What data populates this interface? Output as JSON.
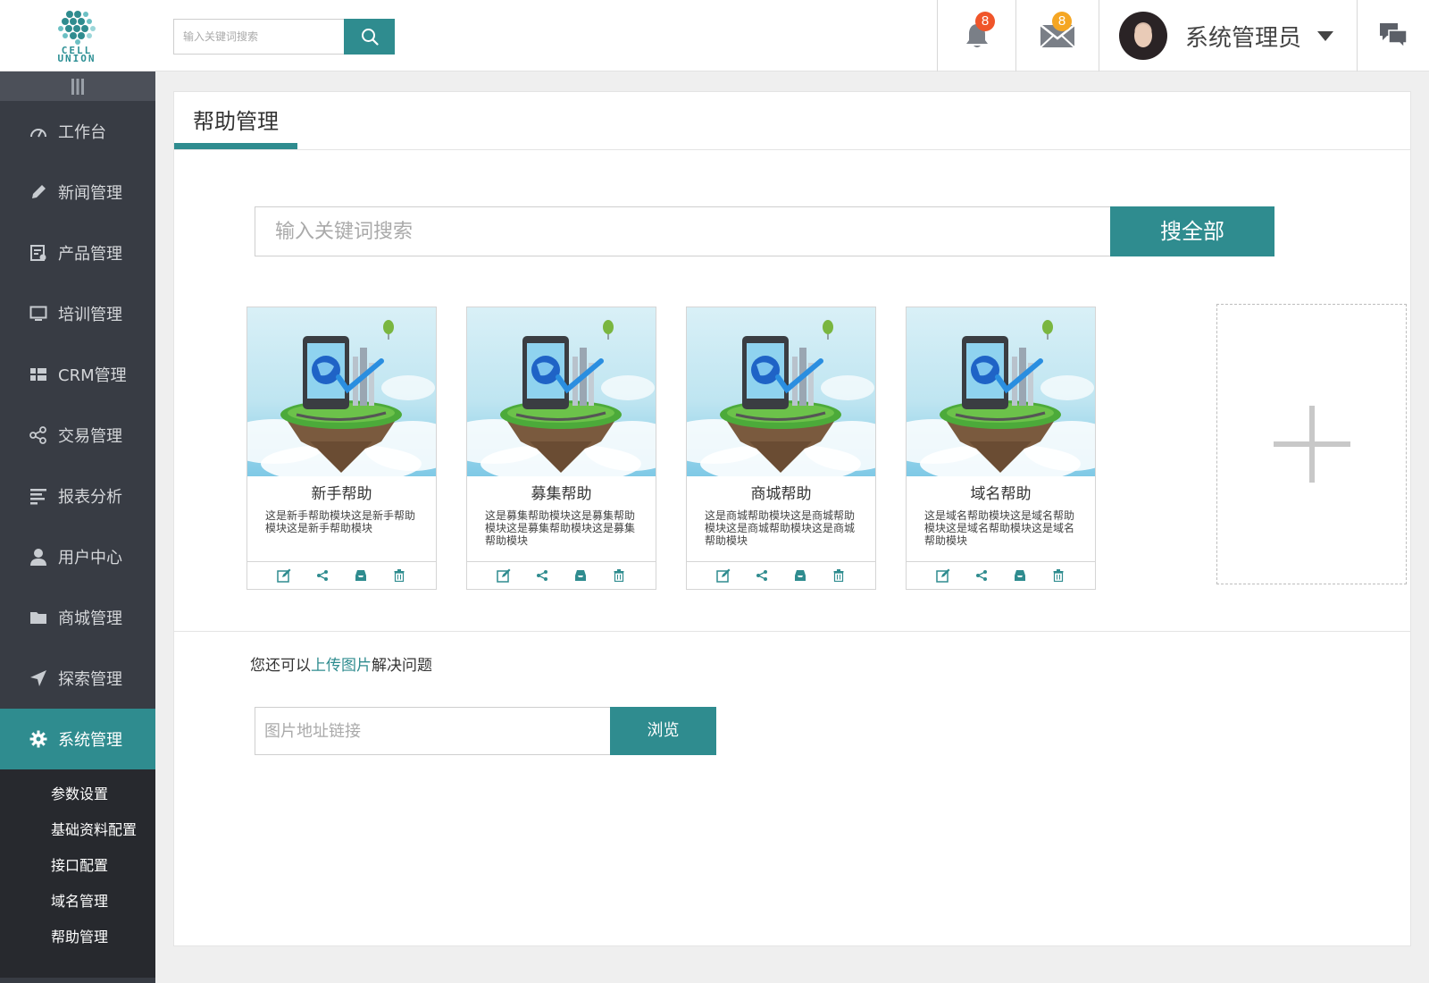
{
  "logo": {
    "line1": "CELL",
    "line2": "UNION",
    "brand_color": "#2f8c8f"
  },
  "header": {
    "search_placeholder": "输入关键词搜索",
    "search_icon": "search-icon",
    "notifications": {
      "icon": "bell-icon",
      "count": "8",
      "badge_color": "#f0552a"
    },
    "messages": {
      "icon": "mail-icon",
      "count": "8",
      "badge_color": "#f5a623"
    },
    "user": {
      "name": "系统管理员"
    },
    "chat_icon": "chat-icon"
  },
  "sidebar": {
    "items": [
      {
        "label": "工作台",
        "icon": "dashboard-icon"
      },
      {
        "label": "新闻管理",
        "icon": "pencil-icon"
      },
      {
        "label": "产品管理",
        "icon": "product-icon"
      },
      {
        "label": "培训管理",
        "icon": "monitor-icon"
      },
      {
        "label": "CRM管理",
        "icon": "grid-icon"
      },
      {
        "label": "交易管理",
        "icon": "share-icon"
      },
      {
        "label": "报表分析",
        "icon": "report-icon"
      },
      {
        "label": "用户中心",
        "icon": "user-icon"
      },
      {
        "label": "商城管理",
        "icon": "folder-icon"
      },
      {
        "label": "探索管理",
        "icon": "send-icon"
      },
      {
        "label": "系统管理",
        "icon": "gear-icon",
        "active": true
      }
    ],
    "submenu": [
      {
        "label": "参数设置"
      },
      {
        "label": "基础资料配置"
      },
      {
        "label": "接口配置"
      },
      {
        "label": "域名管理"
      },
      {
        "label": "帮助管理"
      }
    ]
  },
  "panel": {
    "title": "帮助管理",
    "search_placeholder": "输入关键词搜索",
    "search_button": "搜全部",
    "cards": [
      {
        "title": "新手帮助",
        "desc": "这是新手帮助模块这是新手帮助模块这是新手帮助模块"
      },
      {
        "title": "募集帮助",
        "desc": "这是募集帮助模块这是募集帮助模块这是募集帮助模块这是募集帮助模块"
      },
      {
        "title": "商城帮助",
        "desc": "这是商城帮助模块这是商城帮助模块这是商城帮助模块这是商城帮助模块"
      },
      {
        "title": "域名帮助",
        "desc": "这是域名帮助模块这是域名帮助模块这是域名帮助模块这是域名帮助模块"
      }
    ],
    "card_actions": [
      "edit-icon",
      "share-icon",
      "archive-icon",
      "trash-icon"
    ],
    "add_icon": "plus-icon",
    "upload_hint_before": "您还可以",
    "upload_hint_link": "上传图片",
    "upload_hint_after": "解决问题",
    "url_placeholder": "图片地址链接",
    "browse_button": "浏览"
  }
}
